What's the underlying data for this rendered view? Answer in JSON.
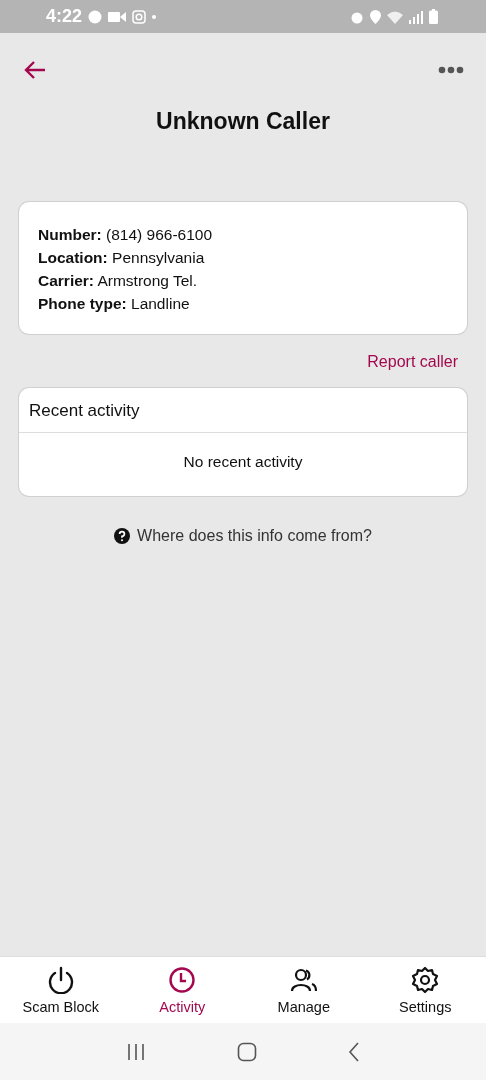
{
  "status_bar": {
    "time": "4:22"
  },
  "header": {
    "title": "Unknown Caller"
  },
  "caller_info": [
    "**Number:** (814) 966-6100",
    "**Location:** Pennsylvania",
    "**Carrier:** Armstrong Tel.",
    "**Phone type:** Landline"
  ],
  "report_link": "Report caller",
  "recent_activity": {
    "title": "Recent activity",
    "empty_text": "No recent activity"
  },
  "help_link": "Where does this info come from?",
  "bottom_nav": [
    {
      "label": "Scam Block",
      "kind": "power",
      "selected": false
    },
    {
      "label": "Activity",
      "kind": "clock",
      "selected": true
    },
    {
      "label": "Manage",
      "kind": "people",
      "selected": false
    },
    {
      "label": "Settings",
      "kind": "gear",
      "selected": false
    }
  ]
}
